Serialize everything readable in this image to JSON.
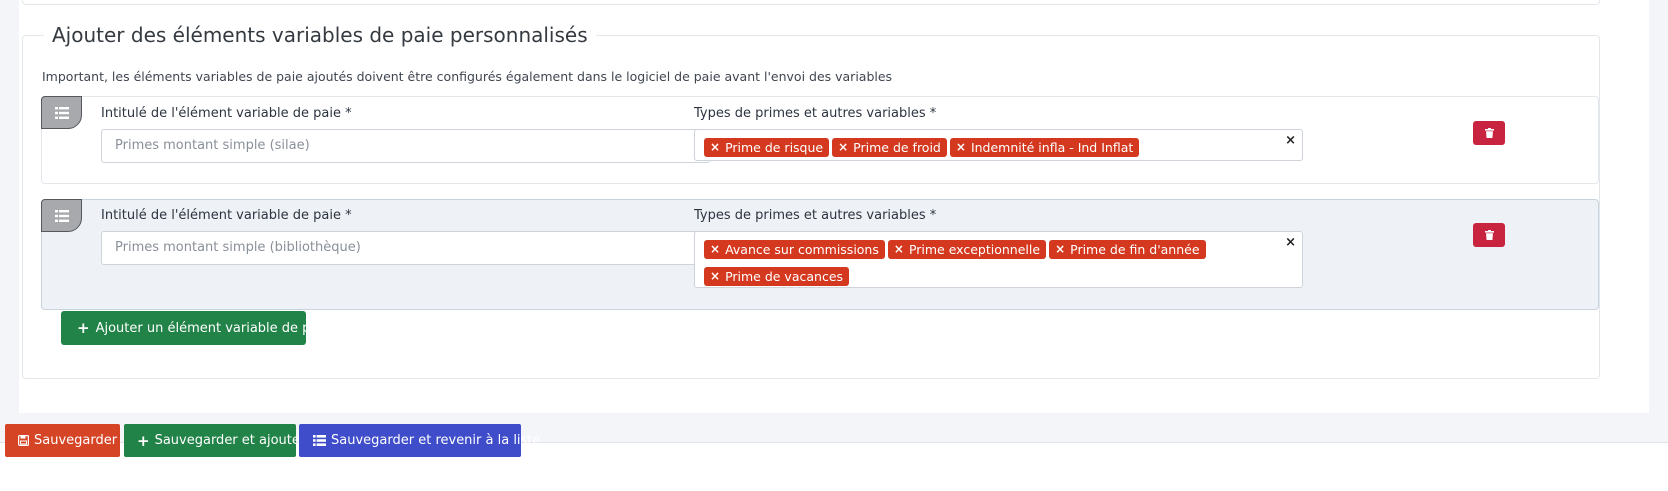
{
  "section": {
    "legend": "Ajouter des éléments variables de paie personnalisés",
    "info": "Important, les éléments variables de paie ajoutés doivent être configurés également dans le logiciel de paie avant l'envoi des variables"
  },
  "rows": [
    {
      "label_name": "Intitulé de l'élément variable de paie *",
      "name_value": "Primes montant simple (silae)",
      "label_types": "Types de primes et autres variables *",
      "tags": [
        "Prime de risque",
        "Prime de froid",
        "Indemnité infla - Ind Inflat"
      ],
      "tag_remove": "×",
      "clear": "×"
    },
    {
      "label_name": "Intitulé de l'élément variable de paie *",
      "name_value": "Primes montant simple (bibliothèque)",
      "label_types": "Types de primes et autres variables *",
      "tags": [
        "Avance sur commissions",
        "Prime exceptionnelle",
        "Prime de fin d'année",
        "Prime de vacances"
      ],
      "tag_remove": "×",
      "clear": "×"
    }
  ],
  "add_button": {
    "icon": "plus-icon",
    "label": "Ajouter un élément variable de paie"
  },
  "footer": {
    "save": {
      "icon": "floppy-icon",
      "label": "Sauvegarder",
      "color": "#d64426"
    },
    "save_add": {
      "icon": "plus-icon",
      "label": "Sauvegarder et ajouter",
      "color": "#218347"
    },
    "save_list": {
      "icon": "list-icon",
      "label": "Sauvegarder et revenir à la liste",
      "color": "#3f4dca"
    }
  },
  "colors": {
    "tag": "#d4381f",
    "delete": "#c9243f",
    "handle": "#a7a9ad"
  }
}
